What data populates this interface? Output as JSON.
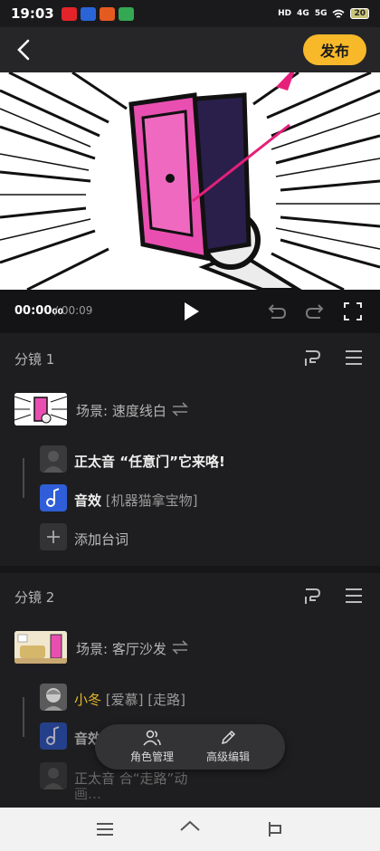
{
  "status": {
    "time": "19:03",
    "signal_4g": "4G",
    "signal_5g": "5G",
    "hd": "HD",
    "battery": "20"
  },
  "toolbar": {
    "publish_label": "发布"
  },
  "player": {
    "current_time": "00:00",
    "current_time_sub": "00",
    "total_time": "/ 00:09"
  },
  "scenes": [
    {
      "title": "分镜 1",
      "scene_label": "场景: 速度线白",
      "lines": [
        {
          "role": "正太音",
          "text": " “任意门”它来咯!"
        },
        {
          "role": "音效",
          "text": " [机器猫拿宝物]"
        }
      ],
      "add_line_label": "添加台词"
    },
    {
      "title": "分镜 2",
      "scene_label": "场景: 客厅沙发",
      "lines": [
        {
          "role": "小冬",
          "text": " [爱慕] [走路]"
        },
        {
          "role": "音效",
          "text": ""
        },
        {
          "role": "正太音",
          "text": "                合“走路”动"
        },
        {
          "role": "",
          "text": "画…"
        }
      ]
    }
  ],
  "floating_bar": {
    "roles_label": "角色管理",
    "advanced_label": "高级编辑"
  },
  "colors": {
    "accent": "#f7b82a",
    "door_pink": "#e94fb0",
    "arrow": "#e6207a"
  }
}
